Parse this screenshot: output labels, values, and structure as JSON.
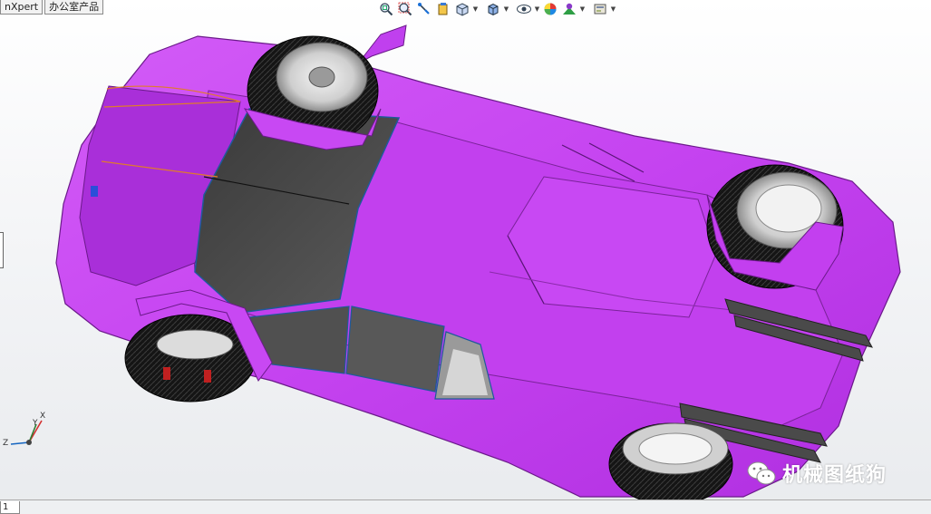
{
  "tabs": [
    {
      "label": "nXpert"
    },
    {
      "label": "办公室产品"
    }
  ],
  "hud_toolbar": {
    "buttons": [
      {
        "icon": "zoom-to-fit-icon"
      },
      {
        "icon": "zoom-to-area-icon"
      },
      {
        "icon": "previous-view-icon"
      },
      {
        "icon": "section-view-icon"
      },
      {
        "icon": "view-orientation-icon",
        "dropdown": true
      },
      {
        "icon": "display-style-icon",
        "dropdown": true
      },
      {
        "icon": "hide-show-items-icon",
        "dropdown": true
      },
      {
        "icon": "edit-appearance-icon"
      },
      {
        "icon": "apply-scene-icon",
        "dropdown": true
      },
      {
        "icon": "view-settings-icon",
        "dropdown": true
      }
    ]
  },
  "triad": {
    "x": "X",
    "y": "Y",
    "z": "Z"
  },
  "model": {
    "body_color": "#cc44f2",
    "name": "car-model"
  },
  "watermark": {
    "text": "机械图纸狗"
  },
  "statusbar": {
    "sheet_label": "1"
  }
}
